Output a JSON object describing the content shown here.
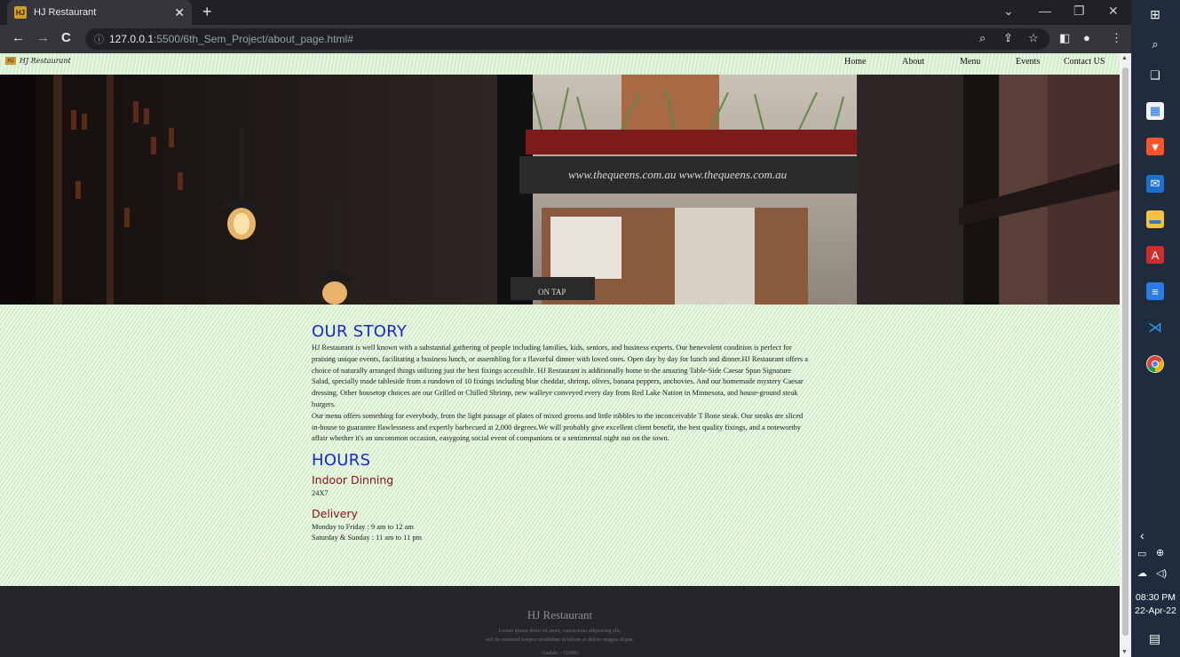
{
  "browser": {
    "tab_title": "HJ Restaurant",
    "tab_favicon": "HJ",
    "url_host": "127.0.0.1",
    "url_path": ":5500/6th_Sem_Project/about_page.html#"
  },
  "site": {
    "logo_mark": "HJ",
    "logo_text": "HJ Restaurant",
    "nav": [
      "Home",
      "About",
      "Menu",
      "Events",
      "Contact US"
    ],
    "hero_sign": "www.thequeens.com.au   www.thequeens.com.au",
    "hero_plaque": "ON TAP"
  },
  "story": {
    "heading": "OUR STORY",
    "p1": "HJ Restaurant is well known with a substantial gathering of people including families, kids, seniors, and business experts. Our benevolent condition is perfect for praising unique events, facilitating a business lunch, or assembling for a flavorful dinner with loved ones. Open day by day for lunch and dinner.HJ Restaurant offers a choice of naturally arranged things utilizing just the best fixings accessible. HJ Restaurant is additionally home to the amazing Table-Side Caesar Spun Signature Salad, specially made tableside from a rundown of 10 fixings including blue cheddar, shrimp, olives, banana peppers, anchovies. And our homemade mystery Caesar dressing. Other housetop choices are our Grilled or Chilled Shrimp, new walleye conveyed every day from Red Lake Nation in Minnesota, and house-ground steak burgers.",
    "p2": "Our menu offers something for everybody, from the light passage of plates of mixed greens and little nibbles to the inconceivable T Bone steak. Our steaks are sliced in-house to guarantee flawlessness and expertly barbecued at 2,000 degrees.We will probably give excellent client benefit, the best quality fixings, and a noteworthy affair whether it's an uncommon occasion, easygoing social event of companions or a sentimental night out on the town."
  },
  "hours": {
    "heading": "HOURS",
    "indoor_title": "Indoor Dinning",
    "indoor_time": "24X7",
    "delivery_title": "Delivery",
    "delivery_weekday": "Monday to Friday : 9 am to 12 am",
    "delivery_weekend": "Saturday & Sunday : 11 am to 11 pm"
  },
  "footer": {
    "brand": "HJ Restaurant",
    "line1": "Lorem ipsum dolor sit amet, consectetur adipiscing elit,",
    "line2": "sed do eiusmod tempor incididunt ut labore et dolore magna aliqua.",
    "line3": "Ambala - 133001"
  },
  "taskbar": {
    "time": "08:30 PM",
    "date": "22-Apr-22"
  },
  "colors": {
    "heading_blue": "#1a25d8",
    "heading_red": "#8a1010",
    "page_bg": "#d9f5d0",
    "footer_bg": "#25262b"
  }
}
